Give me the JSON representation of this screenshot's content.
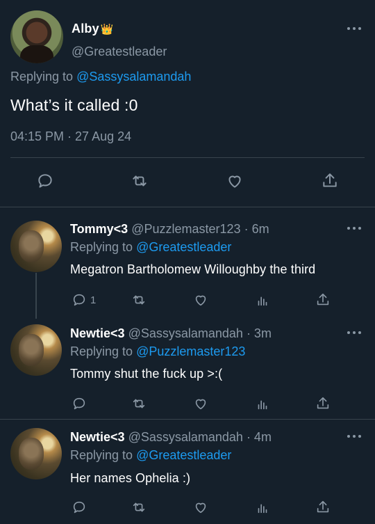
{
  "colors": {
    "background": "#15202b",
    "accent": "#1d9bf0",
    "muted": "#8b98a5",
    "divider": "#38444d"
  },
  "main_tweet": {
    "name": "Alby",
    "badge_icon": "crown-icon",
    "badge_glyph": "👑",
    "handle": "@Greatestleader",
    "replying_prefix": "Replying to",
    "replying_to": "@Sassysalamandah",
    "text": "What’s it called :0",
    "timestamp": "04:15 PM · 27 Aug 24",
    "actions": [
      "reply-icon",
      "retweet-icon",
      "like-icon",
      "share-icon"
    ]
  },
  "replies": [
    {
      "name": "Tommy<3",
      "handle": "@Puzzlemaster123",
      "time": "· 6m",
      "replying_prefix": "Replying to",
      "replying_to": "@Greatestleader",
      "text": "Megatron Bartholomew Willoughby the third",
      "reply_count": "1",
      "actions": [
        "reply-icon",
        "retweet-icon",
        "like-icon",
        "analytics-icon",
        "share-icon"
      ]
    },
    {
      "name": "Newtie<3",
      "handle": "@Sassysalamandah",
      "time": "· 3m",
      "replying_prefix": "Replying to",
      "replying_to": "@Puzzlemaster123",
      "text": "Tommy shut the fuck up >:(",
      "reply_count": "",
      "actions": [
        "reply-icon",
        "retweet-icon",
        "like-icon",
        "analytics-icon",
        "share-icon"
      ]
    },
    {
      "name": "Newtie<3",
      "handle": "@Sassysalamandah",
      "time": "· 4m",
      "replying_prefix": "Replying to",
      "replying_to": "@Greatestleader",
      "text": "Her names Ophelia :)",
      "reply_count": "",
      "actions": [
        "reply-icon",
        "retweet-icon",
        "like-icon",
        "analytics-icon",
        "share-icon"
      ]
    }
  ]
}
